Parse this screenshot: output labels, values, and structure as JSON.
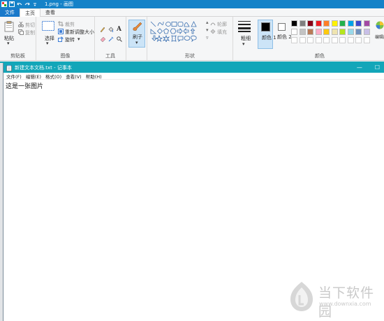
{
  "paint": {
    "title": "1.png - 画图",
    "tabs": [
      "文件",
      "主页",
      "查看"
    ],
    "groups": {
      "clipboard": {
        "label": "剪贴板",
        "paste": "粘贴",
        "cut": "剪切",
        "copy": "复制"
      },
      "image": {
        "label": "图像",
        "select": "选择",
        "crop": "裁剪",
        "resize": "重新调整大小",
        "rotate": "旋转"
      },
      "tools": {
        "label": "工具"
      },
      "brushes": {
        "label": "刷子"
      },
      "shapes": {
        "label": "形状",
        "outline": "轮廓",
        "fill": "填充"
      },
      "size": {
        "label": "粗细"
      },
      "colors": {
        "label": "颜色",
        "color1": "颜色 1",
        "color2": "颜色 2",
        "edit": "编辑颜色"
      }
    },
    "palette": [
      "#000000",
      "#7f7f7f",
      "#880015",
      "#ed1c24",
      "#ff7f27",
      "#fff200",
      "#22b14c",
      "#00a2e8",
      "#3f48cc",
      "#a349a4",
      "#ffffff",
      "#c3c3c3",
      "#b97a57",
      "#ffaec9",
      "#ffc90e",
      "#efe4b0",
      "#b5e61d",
      "#99d9ea",
      "#7092be",
      "#c8bfe7"
    ]
  },
  "notepad": {
    "title": "新建文本文档.txt - 记事本",
    "menu": [
      "文件(F)",
      "编辑(E)",
      "格式(O)",
      "查看(V)",
      "帮助(H)"
    ],
    "content": "这是一张图片",
    "minimize": "—",
    "maximize": "☐"
  },
  "watermark": {
    "name": "当下软件园",
    "url": "www.downxia.com"
  }
}
